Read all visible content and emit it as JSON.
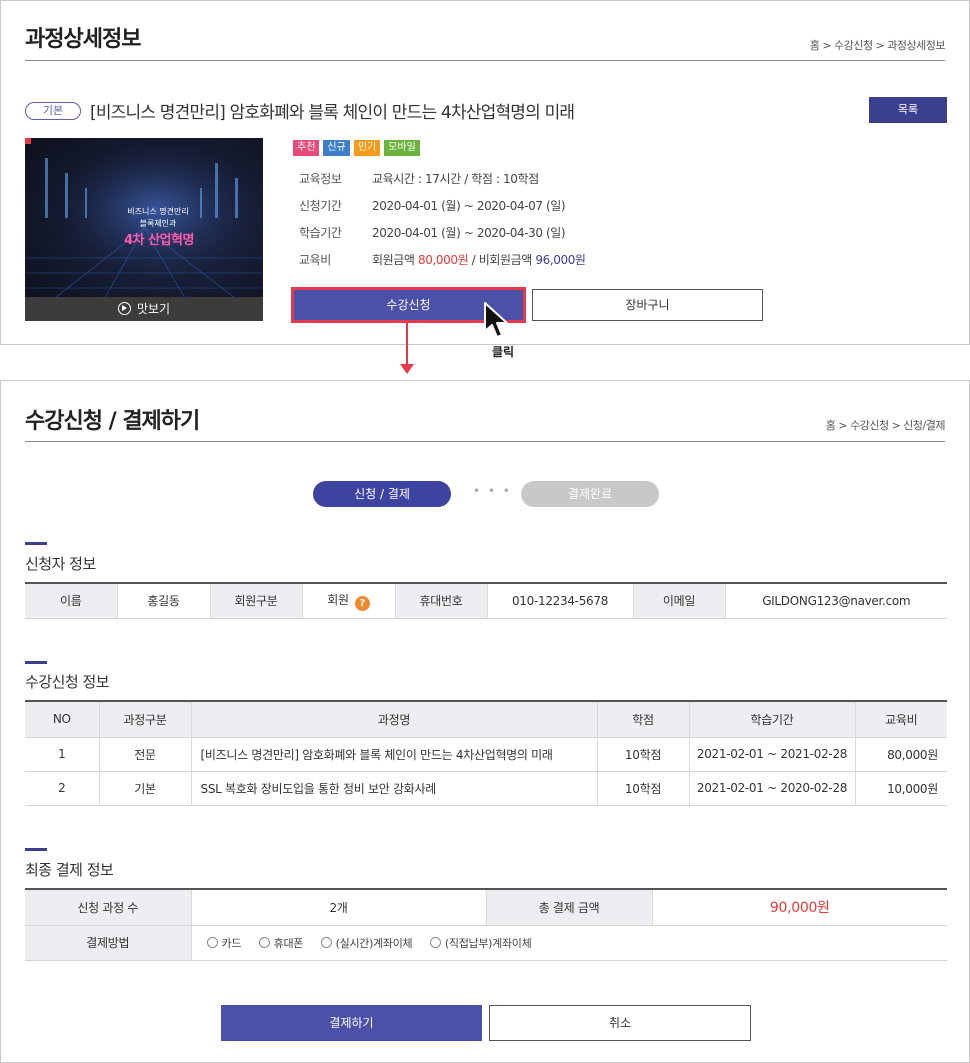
{
  "top": {
    "title": "과정상세정보",
    "breadcrumb": "홈 > 수강신청 > 과정상세정보",
    "course_tag": "기본",
    "course_title": "[비즈니스 명견만리] 암호화폐와 블록 체인이 만드는 4차산업혁명의 미래",
    "list_button": "목록",
    "thumbnail": {
      "line1": "비즈니스 명견만리",
      "line2": "블록체인과",
      "line3": "4차 산업혁명",
      "preview_label": "맛보기"
    },
    "badges": [
      {
        "label": "추천",
        "color": "#e84a7a"
      },
      {
        "label": "신규",
        "color": "#3f7fc9"
      },
      {
        "label": "인기",
        "color": "#f59b1c"
      },
      {
        "label": "모바일",
        "color": "#6cb33e"
      }
    ],
    "info": {
      "edu_label": "교육정보",
      "edu_value": "교육시간 : 17시간 / 학점 : 10학점",
      "apply_label": "신청기간",
      "apply_value": "2020-04-01 (월) ~ 2020-04-07 (일)",
      "study_label": "학습기간",
      "study_value": "2020-04-01 (월) ~ 2020-04-30 (일)",
      "fee_label": "교육비",
      "member_fee_label": "회원금액",
      "member_fee": "80,000원",
      "separator": "/",
      "nonmember_fee_label": "비회원금액",
      "nonmember_fee": "96,000원"
    },
    "apply_button": "수강신청",
    "cart_button": "장바구니",
    "click_label": "클릭"
  },
  "bottom": {
    "title": "수강신청 / 결제하기",
    "breadcrumb": "홈 > 수강신청 > 신청/결제",
    "steps": {
      "step1": "신청 / 결제",
      "dots": "• • •",
      "step2": "결제완료"
    },
    "applicant": {
      "section_title": "신청자 정보",
      "name_label": "이름",
      "name_value": "홍길동",
      "type_label": "회원구분",
      "type_value": "회원",
      "help_icon": "?",
      "phone_label": "휴대번호",
      "phone_value": "010-12234-5678",
      "email_label": "이메일",
      "email_value": "GILDONG123@naver.com"
    },
    "courses": {
      "section_title": "수강신청 정보",
      "headers": [
        "NO",
        "과정구분",
        "과정명",
        "학점",
        "학습기간",
        "교육비"
      ],
      "rows": [
        {
          "no": "1",
          "type": "전문",
          "name": "[비즈니스 명견만리] 암호화폐와 블록 체인이 만드는 4차산업혁명의 미래",
          "credit": "10학점",
          "period": "2021-02-01 ~ 2021-02-28",
          "fee": "80,000원"
        },
        {
          "no": "2",
          "type": "기본",
          "name": "SSL 복호화 장비도입을 통한 정비 보안 강화사례",
          "credit": "10학점",
          "period": "2021-02-01 ~ 2020-02-28",
          "fee": "10,000원"
        }
      ]
    },
    "payment": {
      "section_title": "최종 결제 정보",
      "count_label": "신청 과정 수",
      "count_value": "2개",
      "total_label": "총 결제 금액",
      "total_value": "90,000원",
      "method_label": "결제방법",
      "methods": [
        "카드",
        "휴대폰",
        "(실시간)계좌이체",
        "(직접납부)계좌이체"
      ]
    },
    "pay_button": "결제하기",
    "cancel_button": "취소"
  }
}
